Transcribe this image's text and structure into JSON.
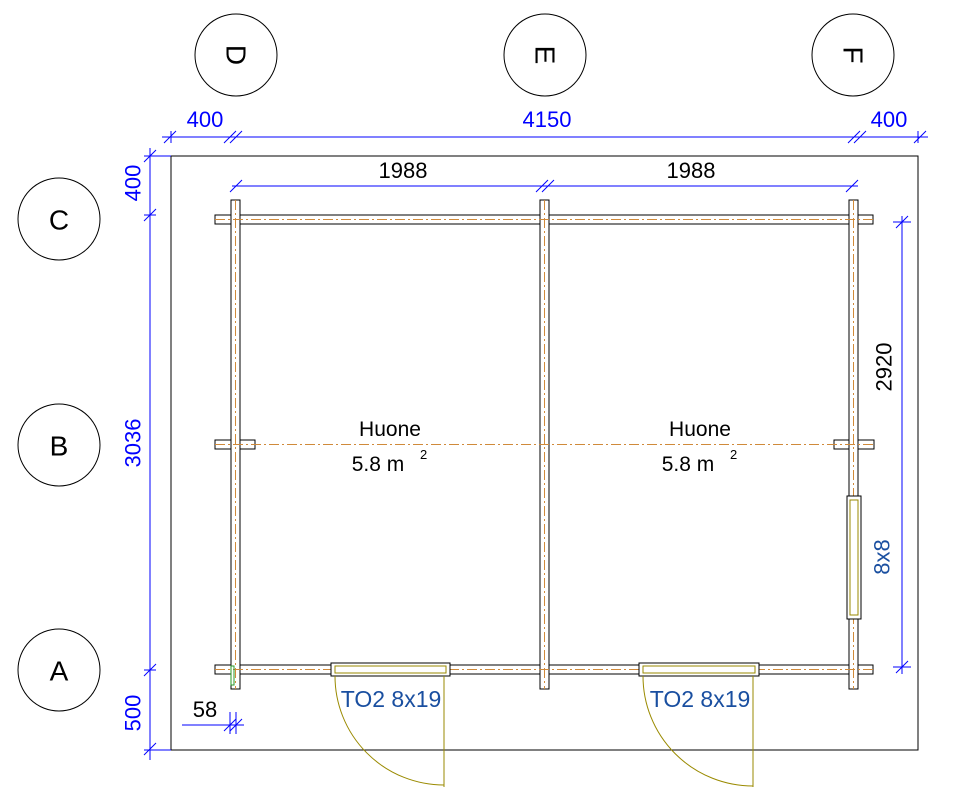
{
  "grid": {
    "columns": [
      "D",
      "E",
      "F"
    ],
    "rows": [
      "C",
      "B",
      "A"
    ]
  },
  "dimensions": {
    "top_outer_left": "400",
    "top_main": "4150",
    "top_outer_right": "400",
    "inner_left": "1988",
    "inner_right": "1988",
    "left_top": "400",
    "left_main": "3036",
    "left_bottom": "500",
    "right_height": "2920",
    "bottom_corner": "58"
  },
  "rooms": [
    {
      "name": "Huone",
      "area": "5.8 m",
      "unit_sup": "2"
    },
    {
      "name": "Huone",
      "area": "5.8 m",
      "unit_sup": "2"
    }
  ],
  "doors": [
    "TO2 8x19",
    "TO2 8x19"
  ],
  "window": "8x8",
  "colors": {
    "dimension": "#0000ff",
    "door_label": "#1a4fa0",
    "door_arc": "#9a8a00",
    "centerline": "#d08a3a",
    "wall": "#000000"
  }
}
